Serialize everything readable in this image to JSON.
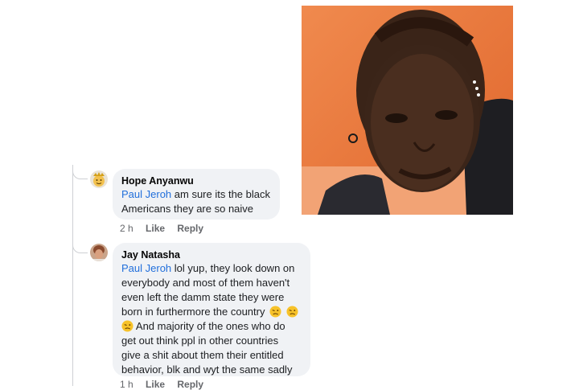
{
  "comments": [
    {
      "author": "Hope Anyanwu",
      "mention": "Paul Jeroh",
      "text": "am sure its the black Americans they are so naive",
      "time": "2 h",
      "like_label": "Like",
      "reply_label": "Reply",
      "avatar_icon": "crowned-face-avatar"
    },
    {
      "author": "Jay Natasha",
      "mention": "Paul Jeroh",
      "line1_text": "lol yup, they look down on",
      "line2_text": "everybody and most of them haven't",
      "line3_text": "even left the damm state they were",
      "line4_text": "born in furthermore the country",
      "line5_text": "And majority of the ones who do",
      "line6_text": "get out think ppl in other countries",
      "line7_text": "give a shit about them their entitled",
      "line8_text": "behavior, blk and wyt the same sadly",
      "emoji_icon": "woozy-face-emoji",
      "time": "1 h",
      "like_label": "Like",
      "reply_label": "Reply",
      "avatar_icon": "profile-photo-avatar"
    }
  ],
  "colors": {
    "mention": "#216fdb",
    "bubble": "#f0f2f5",
    "meta": "#65676b"
  }
}
